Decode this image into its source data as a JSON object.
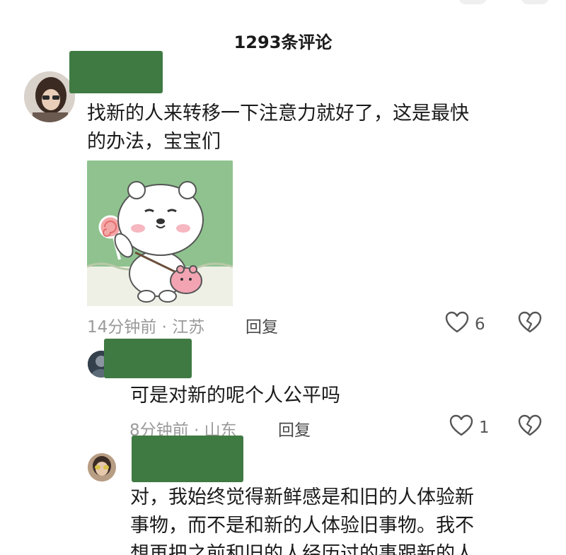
{
  "header": {
    "title": "1293条评论"
  },
  "comments": [
    {
      "text_line1": "找新的人来转移一下注意力就好了，这是最快",
      "text_line2": "的办法，宝宝们",
      "meta": "14分钟前 · 江苏",
      "reply_label": "回复",
      "like_count": "6",
      "has_image": true
    },
    {
      "text_line1": "可是对新的呢个人公平吗",
      "meta": "8分钟前 · 山东",
      "reply_label": "回复",
      "like_count": "1"
    },
    {
      "text_line1": "对，我始终觉得新鲜感是和旧的人体验新",
      "text_line2": "事物，而不是和新的人体验旧事物。我不",
      "text_line3": "想再把之前和旧的人经历过的事跟新的人"
    }
  ],
  "colors": {
    "redaction": "#3f7a43",
    "meta_gray": "#9a9a9a",
    "sticker_bg": "#8fc28f"
  },
  "icons": [
    "heart-outline-icon",
    "broken-heart-icon"
  ]
}
